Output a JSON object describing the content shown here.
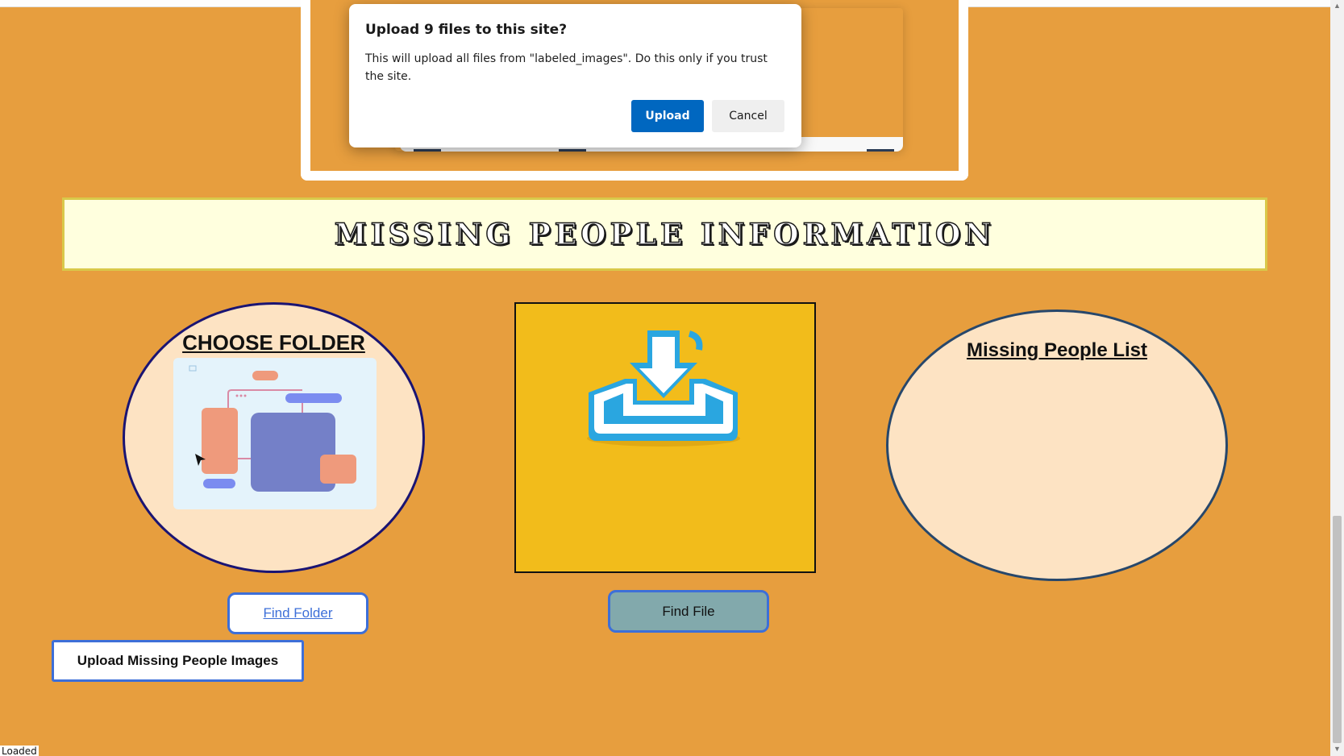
{
  "dialog": {
    "title": "Upload 9 files to this site?",
    "message": "This will upload all files from \"labeled_images\". Do this only if you trust the site.",
    "upload_label": "Upload",
    "cancel_label": "Cancel"
  },
  "banner": {
    "title": "MISSING PEOPLE INFORMATION"
  },
  "folder_panel": {
    "title": "CHOOSE FOLDER",
    "button_label": "Find Folder"
  },
  "file_panel": {
    "button_label": "Find File"
  },
  "list_panel": {
    "title": "Missing People List"
  },
  "upload_images_label": "Upload Missing People Images",
  "status_bar": {
    "text": "Loaded"
  },
  "colors": {
    "page_bg": "#e79e3e",
    "banner_bg": "#ffffde",
    "circle_bg": "#fde3c3",
    "image_box_bg": "#f2bc1b",
    "accent_blue": "#0067c0",
    "button_border": "#3d6fd8",
    "find_file_bg": "#82a9ac"
  },
  "icons": {
    "folder_illustration": "flowchart-illustration",
    "download": "download-tray-icon"
  }
}
